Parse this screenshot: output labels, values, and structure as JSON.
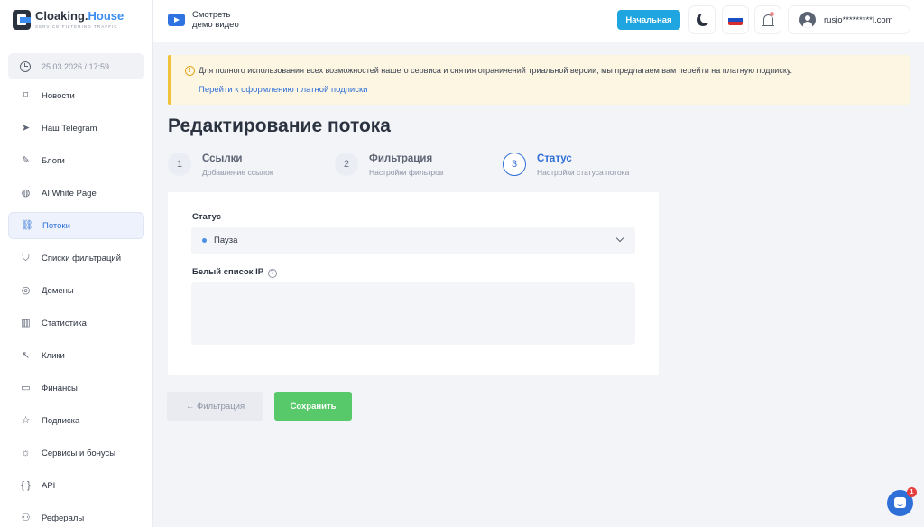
{
  "brand": {
    "title_main": "Cloaking.",
    "title_accent": "House",
    "subtitle": "SERVICE FILTERING TRAFFIC"
  },
  "sidebar": {
    "datetime": "25.03.2026 / 17:59",
    "items": [
      {
        "name": "news",
        "label": "Новости",
        "icon": "⌑"
      },
      {
        "name": "telegram",
        "label": "Наш Telegram",
        "icon": "➤"
      },
      {
        "name": "blogs",
        "label": "Блоги",
        "icon": "✎"
      },
      {
        "name": "ai-white-page",
        "label": "AI White Page",
        "icon": "◍"
      },
      {
        "name": "streams",
        "label": "Потоки",
        "icon": "⛓",
        "active": true
      },
      {
        "name": "filter-lists",
        "label": "Списки фильтраций",
        "icon": "⛉"
      },
      {
        "name": "domains",
        "label": "Домены",
        "icon": "◎"
      },
      {
        "name": "statistics",
        "label": "Статистика",
        "icon": "▥"
      },
      {
        "name": "clicks",
        "label": "Клики",
        "icon": "↖"
      },
      {
        "name": "finance",
        "label": "Финансы",
        "icon": "▭"
      },
      {
        "name": "subscription",
        "label": "Подписка",
        "icon": "☆"
      },
      {
        "name": "services-bonuses",
        "label": "Сервисы и бонусы",
        "icon": "☼"
      },
      {
        "name": "api",
        "label": "API",
        "icon": "{ }"
      },
      {
        "name": "referrals",
        "label": "Рефералы",
        "icon": "⚇"
      }
    ]
  },
  "topbar": {
    "demo_line1": "Смотреть",
    "demo_line2": "демо видео",
    "plan_label": "Начальная",
    "user_email": "rusjo*********l.com",
    "flag_colors": [
      "#ffffff",
      "#1c4fc4",
      "#d82c2c"
    ],
    "accent": "#1fa6e0"
  },
  "alert": {
    "message": "Для полного использования всех возможностей нашего сервиса и снятия ограничений триальной версии, мы предлагаем вам перейти на платную подписку.",
    "link": "Перейти к оформлению платной подписки",
    "icon": "!"
  },
  "page": {
    "title": "Редактирование потока"
  },
  "steps": [
    {
      "num": "1",
      "title": "Ссылки",
      "sub": "Добавление ссылок"
    },
    {
      "num": "2",
      "title": "Фильтрация",
      "sub": "Настройки фильтров"
    },
    {
      "num": "3",
      "title": "Статус",
      "sub": "Настройки статуса потока",
      "active": true
    }
  ],
  "form": {
    "status_label": "Статус",
    "status_value": "Пауза",
    "whitelist_label": "Белый список IP",
    "help_icon": "?",
    "whitelist_value": ""
  },
  "buttons": {
    "back": "← Фильтрация",
    "save": "Сохранить",
    "save_color": "#58c96a"
  },
  "chat": {
    "badge": "1"
  }
}
